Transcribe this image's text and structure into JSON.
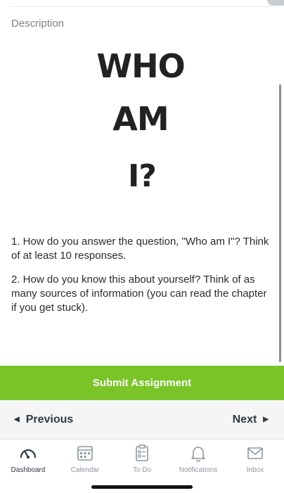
{
  "description_label": "Description",
  "image_text": {
    "line1": "WHO",
    "line2": "AM",
    "line3": "I?"
  },
  "questions": [
    "1. How do you answer the question, \"Who am I\"? Think of at least 10 responses.",
    "2. How do you know this about yourself? Think of as many sources of information (you can read the chapter if you get stuck)."
  ],
  "submit_label": "Submit Assignment",
  "pager": {
    "previous_label": "Previous",
    "next_label": "Next"
  },
  "tabs": [
    {
      "label": "Dashboard",
      "icon": "dashboard-icon"
    },
    {
      "label": "Calendar",
      "icon": "calendar-icon"
    },
    {
      "label": "To Do",
      "icon": "todo-icon"
    },
    {
      "label": "Notifications",
      "icon": "bell-icon"
    },
    {
      "label": "Inbox",
      "icon": "envelope-icon"
    }
  ],
  "colors": {
    "accent_green": "#7ac428",
    "text_dark": "#2d3b45",
    "muted": "#8b969e"
  }
}
